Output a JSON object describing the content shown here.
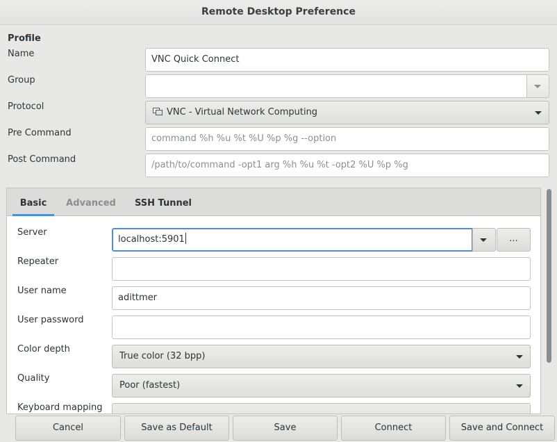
{
  "window": {
    "title": "Remote Desktop Preference"
  },
  "profile": {
    "section_title": "Profile",
    "name": {
      "label": "Name",
      "value": "VNC Quick Connect"
    },
    "group": {
      "label": "Group",
      "value": ""
    },
    "protocol": {
      "label": "Protocol",
      "value": "VNC - Virtual Network Computing",
      "icon": "remote-desktop-icon"
    },
    "pre_command": {
      "label": "Pre Command",
      "placeholder": "command %h %u %t %U %p %g --option"
    },
    "post_command": {
      "label": "Post Command",
      "placeholder": "/path/to/command -opt1 arg %h %u %t -opt2 %U %p %g"
    }
  },
  "tabs": [
    {
      "label": "Basic",
      "state": "active"
    },
    {
      "label": "Advanced",
      "state": "disabled"
    },
    {
      "label": "SSH Tunnel",
      "state": "normal"
    }
  ],
  "basic": {
    "server": {
      "label": "Server",
      "value": "localhost:5901",
      "browse_label": "..."
    },
    "repeater": {
      "label": "Repeater",
      "value": ""
    },
    "username": {
      "label": "User name",
      "value": "adittmer"
    },
    "password": {
      "label": "User password",
      "value": ""
    },
    "color_depth": {
      "label": "Color depth",
      "value": "True color (32 bpp)"
    },
    "quality": {
      "label": "Quality",
      "value": "Poor (fastest)"
    },
    "keyboard_mapping": {
      "label": "Keyboard mapping"
    }
  },
  "buttons": {
    "cancel": "Cancel",
    "save_default": "Save as Default",
    "save": "Save",
    "connect": "Connect",
    "save_connect": "Save and Connect"
  },
  "colors": {
    "accent": "#4a90d9",
    "background": "#e8e8e7"
  }
}
